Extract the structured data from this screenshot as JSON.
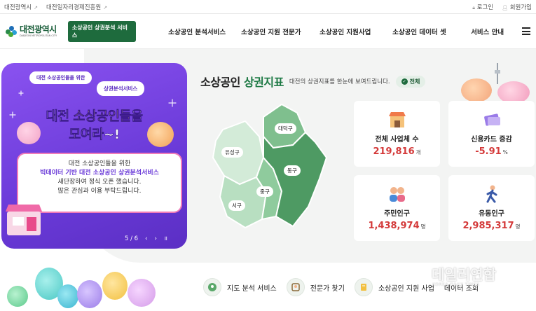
{
  "topbar": {
    "links": [
      "대전광역시",
      "대전일자리경제진흥원"
    ],
    "login": "로그인",
    "signup": "회원가입"
  },
  "nav": {
    "logo_text": "대전광역시",
    "logo_sub": "DAEJEON METROPOLITAN CITY",
    "badge": "소상공인 상권분석 서비스",
    "menu": [
      "소상공인 분석서비스",
      "소상공인 지원 전문가",
      "소상공인 지원사업",
      "소상공인 데이터 셋",
      "서비스 안내"
    ]
  },
  "banner": {
    "bubble1": "대전 소상공인들을 위한",
    "bubble2": "상권분석서비스",
    "headline1_prefix": "대전 ",
    "headline1_highlight": "소상공인들",
    "headline1_suffix": "을",
    "headline2": "모여라~!",
    "notice_line1": "대전 소상공인들을 위한",
    "notice_line2": "빅데이터 기반 대전 소상공인 상권분석서비스",
    "notice_line3": "새단장하여 정식 오픈 했습니다.",
    "notice_line4": "많은 관심과 이용 부탁드립니다.",
    "pager": "5 / 6",
    "prev": "‹",
    "next": "›",
    "pause": "॥"
  },
  "indicators": {
    "title_prefix": "소상공인 ",
    "title_highlight": "상권지표",
    "desc": "대전의 상권지표를 한눈에 보여드립니다.",
    "all_button": "전체"
  },
  "map": {
    "districts": [
      "대덕구",
      "유성구",
      "동구",
      "중구",
      "서구"
    ]
  },
  "cards": [
    {
      "label": "전체 사업체 수",
      "value": "219,816",
      "unit": "개",
      "icon": "store-icon"
    },
    {
      "label": "신용카드 증감",
      "value": "-5.91",
      "unit": "%",
      "icon": "credit-card-icon"
    },
    {
      "label": "주민인구",
      "value": "1,438,974",
      "unit": "명",
      "icon": "residents-icon"
    },
    {
      "label": "유동인구",
      "value": "2,985,317",
      "unit": "명",
      "icon": "walking-person-icon"
    }
  ],
  "services": [
    {
      "label": "지도 분석 서비스",
      "icon": "map-pin-icon"
    },
    {
      "label": "전문가 찾기",
      "icon": "expert-icon"
    },
    {
      "label": "소상공인 지원 사업",
      "icon": "support-icon"
    },
    {
      "label": "데이터 조회",
      "icon": "data-icon"
    }
  ],
  "watermark": {
    "main": "데일리연합",
    "sub": "KOREA DAILY TIMES"
  },
  "colors": {
    "brand_green": "#1e6b3d",
    "banner_purple": "#6a3ad8",
    "value_red": "#d43a3a"
  }
}
